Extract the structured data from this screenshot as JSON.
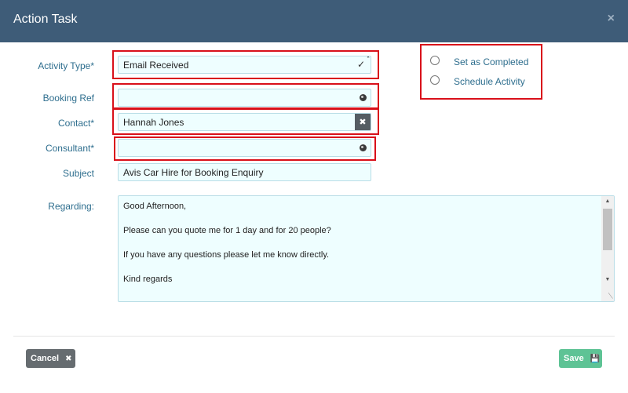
{
  "dialog": {
    "title": "Action Task",
    "close_icon": "×"
  },
  "form": {
    "activity_type": {
      "label": "Activity Type*",
      "value": "Email Received"
    },
    "booking_ref": {
      "label": "Booking Ref",
      "value": ""
    },
    "contact": {
      "label": "Contact*",
      "value": "Hannah Jones"
    },
    "consultant": {
      "label": "Consultant*",
      "value": ""
    },
    "subject": {
      "label": "Subject",
      "value": "Avis Car Hire for Booking Enquiry"
    },
    "regarding": {
      "label": "Regarding:",
      "lines": [
        "Good Afternoon,",
        "Please can you quote me for 1 day and for 20 people?",
        "If you have any questions please let me know directly.",
        "Kind regards"
      ]
    }
  },
  "options": {
    "set_completed": "Set as Completed",
    "schedule_activity": "Schedule Activity"
  },
  "footer": {
    "cancel_label": "Cancel",
    "save_label": "Save"
  },
  "colors": {
    "header": "#3e5c78",
    "label": "#2e6e8e",
    "field_bg": "#eefeff",
    "highlight": "#d9101a",
    "save": "#5ec395",
    "cancel": "#666c70"
  }
}
